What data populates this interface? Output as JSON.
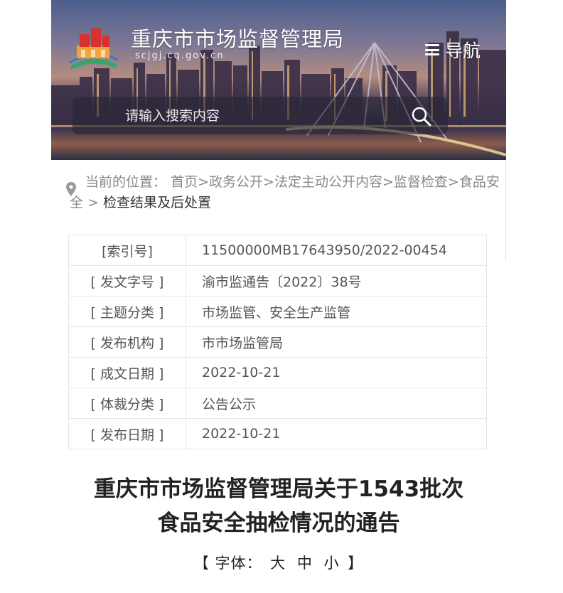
{
  "header": {
    "site_title": "重庆市市场监督管理局",
    "site_domain": "scjgj.cq.gov.cn",
    "nav_label": "导航",
    "search_placeholder": "请输入搜索内容"
  },
  "breadcrumb": {
    "label": "当前的位置：",
    "items": [
      "首页",
      "政务公开",
      "法定主动公开内容",
      "监督检查",
      "食品安全"
    ],
    "separator": ">",
    "current": "检查结果及后处置"
  },
  "meta": [
    {
      "key": "[索引号]",
      "value": "11500000MB17643950/2022-00454"
    },
    {
      "key": "[ 发文字号 ]",
      "value": "渝市监通告〔2022〕38号"
    },
    {
      "key": "[ 主题分类 ]",
      "value": "市场监管、安全生产监管"
    },
    {
      "key": "[ 发布机构 ]",
      "value": "市市场监管局"
    },
    {
      "key": "[ 成文日期 ]",
      "value": "2022-10-21"
    },
    {
      "key": "[ 体裁分类 ]",
      "value": "公告公示"
    },
    {
      "key": "[ 发布日期 ]",
      "value": "2022-10-21"
    }
  ],
  "article": {
    "title_line1": "重庆市市场监督管理局关于1543批次",
    "title_line2": "食品安全抽检情况的通告"
  },
  "font_size": {
    "open": "【",
    "label": "字体：",
    "large": "大",
    "medium": "中",
    "small": "小",
    "close": "】"
  },
  "colors": {
    "logo_red": "#d9312b",
    "logo_orange": "#f2a33a",
    "logo_green": "#3aa56b",
    "logo_blue": "#2f7fc8"
  },
  "icons": {
    "menu": "hamburger-icon",
    "search": "search-icon",
    "location": "location-pin-icon"
  }
}
